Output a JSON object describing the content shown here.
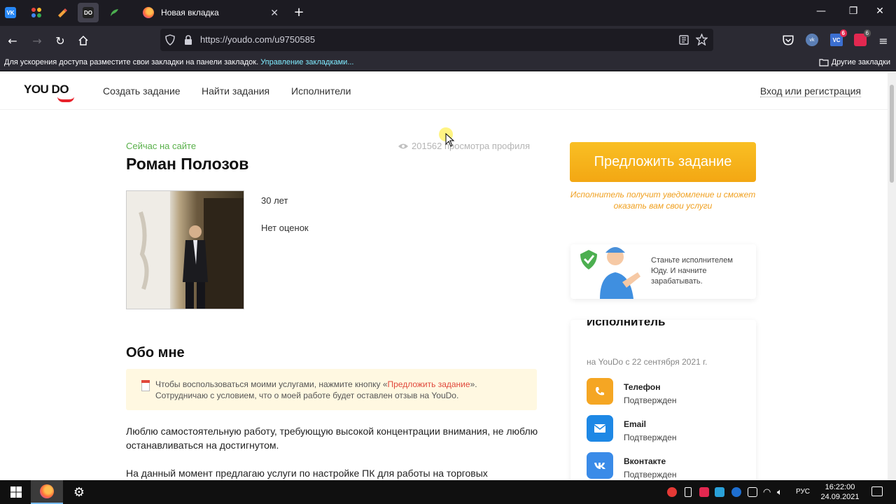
{
  "browser": {
    "tab_title": "Новая вкладка",
    "url": "https://youdo.com/u9750585",
    "bookmarks_message": "Для ускорения доступа разместите свои закладки на панели закладок.",
    "bookmarks_manage_link": "Управление закладками...",
    "other_bookmarks": "Другие закладки",
    "pinned_tabs": [
      "vk-icon",
      "apps-icon",
      "pencil-icon",
      "youdo-icon",
      "feather-icon"
    ],
    "extension_badges": [
      "6",
      "6"
    ],
    "pinned_labels": {
      "vk": "VK",
      "youdo": "DO"
    },
    "extension_labels": {
      "vk": "vk",
      "vc": "VC"
    }
  },
  "site": {
    "logo": "YOU DO",
    "nav": [
      "Создать задание",
      "Найти задания",
      "Исполнители"
    ],
    "login": "Вход или регистрация"
  },
  "profile": {
    "status": "Сейчас на сайте",
    "views": "201562 просмотра профиля",
    "name": "Роман Полозов",
    "age": "30 лет",
    "rating": "Нет оценок"
  },
  "about": {
    "title": "Обо мне",
    "notice_pre": "Чтобы воспользоваться моими услугами, нажмите кнопку «",
    "notice_link": "Предложить задание",
    "notice_post": "». Сотрудничаю с условием, что о моей работе будет оставлен отзыв на YouDo.",
    "paragraph1": "Люблю самостоятельную работу, требующую высокой концентрации внимания, не люблю останавливаться на достигнутом.",
    "paragraph2": "На данный момент предлагаю услуги по настройке ПК для работы на торговых площадках,"
  },
  "sidebar": {
    "cta_label": "Предложить задание",
    "cta_note": "Исполнитель получит уведомление и сможет оказать вам свои услуги",
    "promo_text": "Станьте исполнителем Юду. И начните зарабатывать.",
    "card_title": "Исполнитель",
    "card_since": "на YouDo с 22 сентября 2021 г.",
    "verifications": [
      {
        "label": "Телефон",
        "status": "Подтвержден",
        "icon": "phone-icon",
        "color": "#f5a623"
      },
      {
        "label": "Email",
        "status": "Подтвержден",
        "icon": "mail-icon",
        "color": "#1e88e5"
      },
      {
        "label": "Вконтакте",
        "status": "Подтвержден",
        "icon": "vk-icon",
        "color": "#3a8be8"
      }
    ]
  },
  "taskbar": {
    "lang": "РУС",
    "time": "16:22:00",
    "date": "24.09.2021"
  },
  "colors": {
    "accent": "#f5a623",
    "online": "#59b04a",
    "link_red": "#e0483b"
  }
}
